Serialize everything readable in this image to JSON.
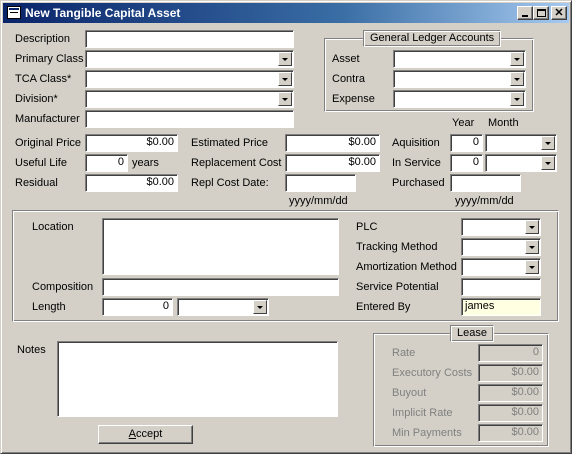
{
  "window": {
    "title": "New Tangible Capital Asset"
  },
  "top_left": {
    "description_label": "Description",
    "primary_class_label": "Primary Class",
    "tca_class_label": "TCA Class*",
    "division_label": "Division*",
    "manufacturer_label": "Manufacturer",
    "description_value": "",
    "primary_class_value": "",
    "tca_class_value": "",
    "division_value": "",
    "manufacturer_value": ""
  },
  "gl_accounts": {
    "caption": "General Ledger Accounts",
    "asset_label": "Asset",
    "contra_label": "Contra",
    "expense_label": "Expense",
    "asset_value": "",
    "contra_value": "",
    "expense_value": ""
  },
  "pricing": {
    "original_price_label": "Original Price",
    "original_price_value": "$0.00",
    "useful_life_label": "Useful Life",
    "useful_life_value": "0",
    "years_label": "years",
    "residual_label": "Residual",
    "residual_value": "$0.00",
    "estimated_price_label": "Estimated Price",
    "estimated_price_value": "$0.00",
    "replacement_cost_label": "Replacement Cost",
    "replacement_cost_value": "$0.00",
    "repl_cost_date_label": "Repl Cost Date:",
    "repl_cost_date_value": "",
    "repl_date_hint": "yyyy/mm/dd"
  },
  "dates": {
    "year_header": "Year",
    "month_header": "Month",
    "aquisition_label": "Aquisition",
    "aquisition_year": "0",
    "aquisition_month": "",
    "in_service_label": "In Service",
    "in_service_year": "0",
    "in_service_month": "",
    "purchased_label": "Purchased",
    "purchased_value": "",
    "purchased_hint": "yyyy/mm/dd"
  },
  "details": {
    "location_label": "Location",
    "location_value": "",
    "composition_label": "Composition",
    "composition_value": "",
    "length_label": "Length",
    "length_value": "0",
    "length_unit": "",
    "plc_label": "PLC",
    "plc_value": "",
    "tracking_method_label": "Tracking Method",
    "tracking_method_value": "",
    "amortization_method_label": "Amortization Method",
    "amortization_method_value": "",
    "service_potential_label": "Service Potential",
    "service_potential_value": "",
    "entered_by_label": "Entered By",
    "entered_by_value": "james"
  },
  "notes": {
    "label": "Notes",
    "value": ""
  },
  "actions": {
    "accept_prefix": "",
    "accept_hotkey": "A",
    "accept_rest": "ccept"
  },
  "lease": {
    "caption": "Lease",
    "rate_label": "Rate",
    "rate_value": "0",
    "executory_costs_label": "Executory Costs",
    "executory_costs_value": "$0.00",
    "buyout_label": "Buyout",
    "buyout_value": "$0.00",
    "implicit_rate_label": "Implicit Rate",
    "implicit_rate_value": "$0.00",
    "min_payments_label": "Min Payments",
    "min_payments_value": "$0.00"
  }
}
